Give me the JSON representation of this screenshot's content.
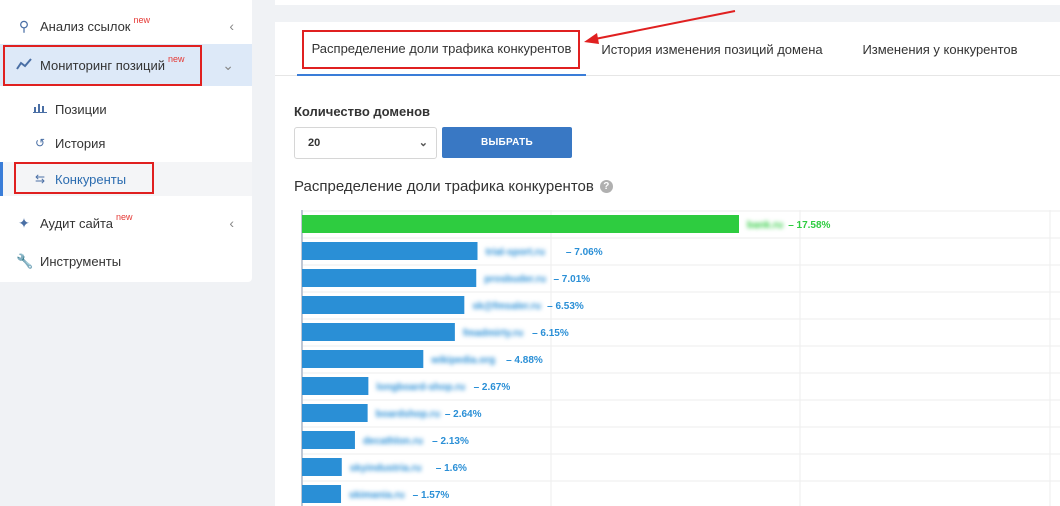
{
  "sidebar": {
    "items": [
      {
        "label": "Анализ ссылок",
        "badge": "new",
        "icon": "search-icon"
      },
      {
        "label": "Мониторинг позиций",
        "badge": "new",
        "icon": "chart-line-icon"
      },
      {
        "label": "Аудит сайта",
        "badge": "new",
        "icon": "magic-wand-icon"
      },
      {
        "label": "Инструменты",
        "badge": "",
        "icon": "wrench-icon"
      }
    ],
    "sub_items": [
      {
        "label": "Позиции",
        "icon": "bar-chart-icon"
      },
      {
        "label": "История",
        "icon": "history-icon"
      },
      {
        "label": "Конкуренты",
        "icon": "exchange-icon"
      }
    ]
  },
  "tabs": [
    {
      "label": "Распределение доли трафика конкурентов"
    },
    {
      "label": "История изменения позиций домена"
    },
    {
      "label": "Изменения у конкурентов"
    }
  ],
  "controls": {
    "domains_label": "Количество доменов",
    "domains_value": "20",
    "select_button": "ВЫБРАТЬ"
  },
  "chart_title": "Распределение доли трафика конкурентов",
  "colors": {
    "accent": "#3978c4",
    "bar_blue": "#2a8fd6",
    "bar_green": "#2ecc40",
    "highlight": "#e02020"
  },
  "chart_data": {
    "type": "bar",
    "orientation": "horizontal",
    "categories": [
      "bank.ru",
      "trial-sport.ru",
      "prosbuder.ru",
      "sk@fmsaler.ru",
      "fmadmirty.ru",
      "wikipedia.org",
      "longboard-shop.ru",
      "boardshop.ru",
      "decathlon.ru",
      "skyindustria.ru",
      "skimania.ru"
    ],
    "values": [
      17.58,
      7.06,
      7.01,
      6.53,
      6.15,
      4.88,
      2.67,
      2.64,
      2.13,
      1.6,
      1.57
    ],
    "labels": [
      "– 17.58%",
      "– 7.06%",
      "– 7.01%",
      "– 6.53%",
      "– 6.15%",
      "– 4.88%",
      "– 2.67%",
      "– 2.64%",
      "– 2.13%",
      "– 1.6%",
      "– 1.57%"
    ],
    "highlight_index": 0,
    "grid": true
  }
}
